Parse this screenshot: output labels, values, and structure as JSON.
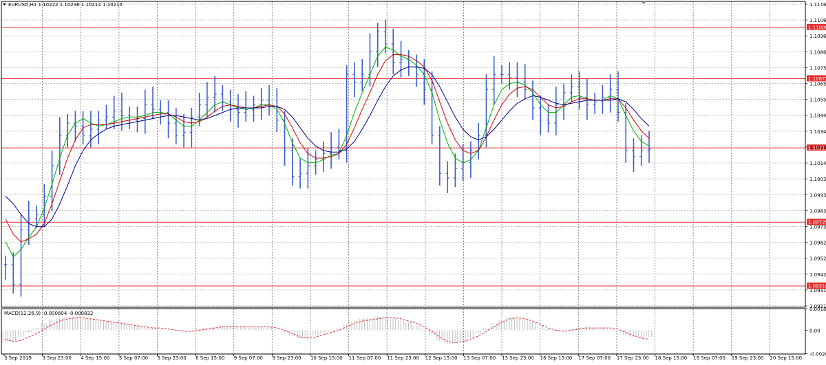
{
  "main_panel": {
    "title": "EURUSD,H1  1.10222 1.10236 1.10212 1.10215",
    "y_range": [
      1.0917,
      1.1118
    ],
    "y_ticks": [
      "1.11165",
      "1.11065",
      "1.10960",
      "1.10860",
      "1.10755",
      "1.10650",
      "1.10550",
      "1.10445",
      "1.10345",
      "1.10240",
      "1.10140",
      "1.10035",
      "1.09935",
      "1.09830",
      "1.09730",
      "1.09625",
      "1.09520",
      "1.09420",
      "1.09315",
      "1.09210"
    ],
    "levels": [
      {
        "label": "1.11009",
        "value": 1.11009
      },
      {
        "label": "1.10672",
        "value": 1.10672
      },
      {
        "label": "1.10217",
        "value": 1.10217
      },
      {
        "label": "1.09729",
        "value": 1.09729
      },
      {
        "label": "1.09310",
        "value": 1.0931
      }
    ]
  },
  "macd_panel": {
    "title": "MACD(12,26,9)  -0.000604  -0.000832",
    "y_range": [
      -0.0021,
      0.0019
    ],
    "y_ticks": [
      "0.001895",
      "0.00",
      "-0.00206"
    ]
  },
  "x_axis": {
    "labels": [
      "3 Sep 2019",
      "3 Sep 23:00",
      "4 Sep 15:00",
      "5 Sep 07:00",
      "5 Sep 23:00",
      "6 Sep 15:00",
      "9 Sep 07:00",
      "9 Sep 23:00",
      "10 Sep 15:00",
      "11 Sep 07:00",
      "11 Sep 23:00",
      "12 Sep 15:00",
      "13 Sep 07:00",
      "13 Sep 23:00",
      "16 Sep 15:00",
      "17 Sep 07:00",
      "17 Sep 23:00",
      "18 Sep 15:00",
      "19 Sep 07:00",
      "19 Sep 23:00",
      "20 Sep 15:00"
    ]
  },
  "chart_data": {
    "type": "line",
    "style": "candlestick-like bars with moving averages and MACD sub-panel",
    "series": [
      {
        "values": [
          1.0945,
          1.0932,
          1.0968,
          1.0975,
          1.0978,
          1.099,
          1.101,
          1.103,
          1.1038,
          1.1036,
          1.103,
          1.1034,
          1.104,
          1.1042,
          1.1046,
          1.1043,
          1.104,
          1.1041,
          1.105,
          1.1047,
          1.1045,
          1.1038,
          1.103,
          1.1032,
          1.1042,
          1.105,
          1.1055,
          1.1057,
          1.1052,
          1.1047,
          1.1045,
          1.1047,
          1.105,
          1.1053,
          1.1049,
          1.104,
          1.102,
          1.1003,
          1.1005,
          1.101,
          1.1014,
          1.1018,
          1.1022,
          1.102,
          1.107,
          1.1065,
          1.107,
          1.1085,
          1.1098,
          1.109,
          1.1078,
          1.108,
          1.1075,
          1.107,
          1.106,
          1.103,
          1.1005,
          1.1002,
          1.1008,
          1.1012,
          1.102,
          1.103,
          1.106,
          1.107,
          1.107,
          1.1068,
          1.1065,
          1.106,
          1.1048,
          1.104,
          1.1038,
          1.105,
          1.1058,
          1.1062,
          1.1055,
          1.105,
          1.1052,
          1.1055,
          1.106,
          1.1045,
          1.102,
          1.1016,
          1.102,
          1.1021
        ]
      },
      {
        "color": "#00b000",
        "values": [
          1.096,
          1.095,
          1.0955,
          1.0963,
          1.097,
          1.0982,
          1.0998,
          1.1015,
          1.103,
          1.1038,
          1.1041,
          1.1038,
          1.1036,
          1.1037,
          1.1039,
          1.1041,
          1.1042,
          1.1042,
          1.1043,
          1.1045,
          1.1045,
          1.1044,
          1.104,
          1.1036,
          1.1036,
          1.104,
          1.1045,
          1.105,
          1.1052,
          1.105,
          1.1048,
          1.1047,
          1.1048,
          1.105,
          1.105,
          1.1047,
          1.1038,
          1.1025,
          1.1015,
          1.1012,
          1.1012,
          1.1014,
          1.1017,
          1.1018,
          1.103,
          1.1045,
          1.1058,
          1.107,
          1.1082,
          1.1088,
          1.1086,
          1.1082,
          1.108,
          1.1076,
          1.107,
          1.1058,
          1.104,
          1.1025,
          1.1015,
          1.1012,
          1.1014,
          1.102,
          1.1035,
          1.105,
          1.106,
          1.1064,
          1.1065,
          1.1063,
          1.1058,
          1.105,
          1.1045,
          1.1045,
          1.105,
          1.1055,
          1.1056,
          1.1054,
          1.1053,
          1.1053,
          1.1056,
          1.1054,
          1.1043,
          1.1033,
          1.1026,
          1.1023
        ]
      },
      {
        "color": "#d00000",
        "values": [
          1.0975,
          1.0965,
          1.096,
          1.0962,
          1.0965,
          1.0972,
          1.0985,
          1.1,
          1.1015,
          1.1027,
          1.1035,
          1.1037,
          1.1037,
          1.1037,
          1.1038,
          1.1039,
          1.104,
          1.1041,
          1.1042,
          1.1043,
          1.1044,
          1.1044,
          1.1042,
          1.1039,
          1.1038,
          1.1039,
          1.1042,
          1.1046,
          1.1049,
          1.105,
          1.1049,
          1.1048,
          1.1048,
          1.1049,
          1.105,
          1.1049,
          1.1044,
          1.1035,
          1.1025,
          1.1018,
          1.1015,
          1.1015,
          1.1016,
          1.1018,
          1.1024,
          1.1035,
          1.1047,
          1.1058,
          1.107,
          1.1079,
          1.1083,
          1.1083,
          1.1082,
          1.1079,
          1.1075,
          1.1066,
          1.1052,
          1.1038,
          1.1027,
          1.102,
          1.1018,
          1.102,
          1.1029,
          1.104,
          1.105,
          1.1057,
          1.1061,
          1.1062,
          1.106,
          1.1055,
          1.105,
          1.1048,
          1.1049,
          1.1052,
          1.1054,
          1.1054,
          1.1053,
          1.1053,
          1.1054,
          1.1054,
          1.1048,
          1.104,
          1.1033,
          1.1028
        ]
      },
      {
        "color": "#00008b",
        "values": [
          1.099,
          1.0985,
          1.0978,
          1.0972,
          1.097,
          1.097,
          1.0975,
          1.0985,
          1.0997,
          1.101,
          1.102,
          1.1027,
          1.1031,
          1.1034,
          1.1036,
          1.1037,
          1.1038,
          1.1039,
          1.104,
          1.1041,
          1.1042,
          1.1043,
          1.1043,
          1.1042,
          1.1041,
          1.104,
          1.1041,
          1.1043,
          1.1045,
          1.1047,
          1.1048,
          1.1048,
          1.1048,
          1.1048,
          1.1049,
          1.1049,
          1.1047,
          1.1042,
          1.1035,
          1.1028,
          1.1023,
          1.102,
          1.1019,
          1.1019,
          1.1021,
          1.1026,
          1.1034,
          1.1043,
          1.1053,
          1.1062,
          1.1069,
          1.1073,
          1.1075,
          1.1075,
          1.1074,
          1.107,
          1.1062,
          1.1052,
          1.1042,
          1.1034,
          1.1029,
          1.1027,
          1.1029,
          1.1034,
          1.104,
          1.1046,
          1.1051,
          1.1054,
          1.1056,
          1.1055,
          1.1053,
          1.1051,
          1.105,
          1.1051,
          1.1052,
          1.1053,
          1.1053,
          1.1053,
          1.1053,
          1.1054,
          1.1052,
          1.1047,
          1.1041,
          1.1036
        ]
      }
    ],
    "macd_signal": [
      -0.0008,
      -0.001,
      -0.0009,
      -0.0006,
      -0.0003,
      0.0001,
      0.0005,
      0.0008,
      0.001,
      0.0011,
      0.0011,
      0.001,
      0.0009,
      0.0008,
      0.0007,
      0.0006,
      0.0005,
      0.0004,
      0.0003,
      0.0002,
      0.0002,
      0.0001,
      0.0,
      -0.0001,
      -0.0001,
      0.0,
      0.0001,
      0.0002,
      0.0003,
      0.0003,
      0.0003,
      0.0003,
      0.0003,
      0.0003,
      0.0003,
      0.0002,
      0.0,
      -0.0003,
      -0.0006,
      -0.0007,
      -0.0006,
      -0.0004,
      -0.0002,
      0.0,
      0.0003,
      0.0006,
      0.0008,
      0.0009,
      0.001,
      0.0011,
      0.0011,
      0.001,
      0.0008,
      0.0006,
      0.0003,
      -0.0001,
      -0.0006,
      -0.001,
      -0.0011,
      -0.001,
      -0.0008,
      -0.0005,
      -0.0001,
      0.0003,
      0.0007,
      0.001,
      0.0011,
      0.001,
      0.0008,
      0.0005,
      0.0002,
      0.0,
      -0.0001,
      0.0,
      0.0001,
      0.0002,
      0.0002,
      0.0002,
      0.0002,
      0.0001,
      -0.0002,
      -0.0005,
      -0.0007,
      -0.0008
    ],
    "macd_hist": [
      -0.0011,
      -0.001,
      -0.0006,
      -0.0002,
      0.0002,
      0.0006,
      0.0009,
      0.0011,
      0.0012,
      0.0012,
      0.0011,
      0.001,
      0.0009,
      0.0008,
      0.0007,
      0.0006,
      0.0005,
      0.0004,
      0.0003,
      0.0002,
      0.0001,
      0.0,
      -0.0001,
      -0.0001,
      0.0,
      0.0001,
      0.0002,
      0.0003,
      0.0004,
      0.0004,
      0.0003,
      0.0003,
      0.0003,
      0.0003,
      0.0003,
      0.0001,
      -0.0002,
      -0.0005,
      -0.0007,
      -0.0007,
      -0.0005,
      -0.0003,
      -0.0001,
      0.0001,
      0.0005,
      0.0008,
      0.001,
      0.0011,
      0.0012,
      0.0012,
      0.0011,
      0.0009,
      0.0007,
      0.0004,
      0.0001,
      -0.0004,
      -0.0009,
      -0.0012,
      -0.0012,
      -0.001,
      -0.0007,
      -0.0003,
      0.0002,
      0.0006,
      0.0009,
      0.0011,
      0.0011,
      0.0009,
      0.0007,
      0.0004,
      0.0001,
      -0.0001,
      -0.0001,
      0.0001,
      0.0002,
      0.0003,
      0.0002,
      0.0002,
      0.0001,
      -0.0001,
      -0.0004,
      -0.0006,
      -0.0007,
      -0.0006
    ]
  },
  "colors": {
    "background": "#ffffff",
    "bar": "#3a5fcd",
    "level_line": "#e33030",
    "level_badge": "#e33030",
    "grid": "#a8a8a8",
    "macd_hist": "#c0c0c0",
    "macd_signal": "#e33030"
  }
}
